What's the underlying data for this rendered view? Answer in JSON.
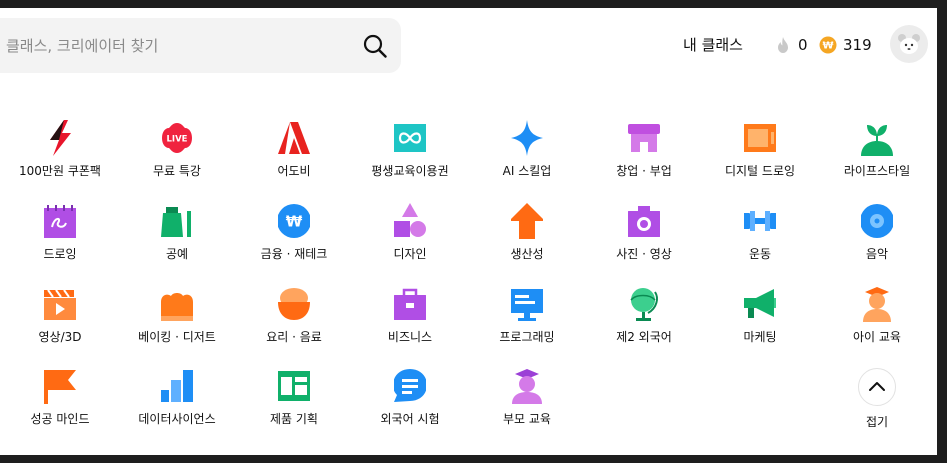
{
  "search": {
    "placeholder": "클래스, 크리에이터 찾기"
  },
  "header": {
    "my_class": "내 클래스",
    "flame_count": "0",
    "coin_count": "319",
    "coin_symbol": "₩"
  },
  "colors": {
    "search_bg": "#f3f3f3",
    "coin": "#f5a623"
  },
  "categories": [
    {
      "label": "100만원 쿠폰팩",
      "icon": "bolt-icon"
    },
    {
      "label": "무료 특강",
      "icon": "live-badge-icon",
      "badge_text": "LIVE"
    },
    {
      "label": "어도비",
      "icon": "adobe-icon"
    },
    {
      "label": "평생교육이용권",
      "icon": "infinity-ticket-icon"
    },
    {
      "label": "AI 스킬업",
      "icon": "sparkle-icon"
    },
    {
      "label": "창업 · 부업",
      "icon": "store-icon"
    },
    {
      "label": "디지털 드로잉",
      "icon": "tablet-icon"
    },
    {
      "label": "라이프스타일",
      "icon": "sprout-icon"
    },
    {
      "label": "드로잉",
      "icon": "sketchbook-icon"
    },
    {
      "label": "공예",
      "icon": "craft-icon"
    },
    {
      "label": "금융 · 재테크",
      "icon": "won-coin-icon",
      "coin_symbol": "₩"
    },
    {
      "label": "디자인",
      "icon": "shapes-icon"
    },
    {
      "label": "생산성",
      "icon": "arrow-up-icon"
    },
    {
      "label": "사진 · 영상",
      "icon": "camera-icon"
    },
    {
      "label": "운동",
      "icon": "dumbbell-icon"
    },
    {
      "label": "음악",
      "icon": "disc-icon"
    },
    {
      "label": "영상/3D",
      "icon": "clapper-icon"
    },
    {
      "label": "베이킹 · 디저트",
      "icon": "bread-icon"
    },
    {
      "label": "요리 · 음료",
      "icon": "bowl-icon"
    },
    {
      "label": "비즈니스",
      "icon": "briefcase-icon"
    },
    {
      "label": "프로그래밍",
      "icon": "monitor-icon"
    },
    {
      "label": "제2 외국어",
      "icon": "globe-icon"
    },
    {
      "label": "마케팅",
      "icon": "megaphone-icon"
    },
    {
      "label": "아이 교육",
      "icon": "kid-icon"
    },
    {
      "label": "성공 마인드",
      "icon": "flag-icon"
    },
    {
      "label": "데이터사이언스",
      "icon": "bar-chart-icon"
    },
    {
      "label": "제품 기획",
      "icon": "layout-icon"
    },
    {
      "label": "외국어 시험",
      "icon": "chat-icon"
    },
    {
      "label": "부모 교육",
      "icon": "graduate-icon"
    }
  ],
  "collapse": {
    "label": "접기"
  }
}
